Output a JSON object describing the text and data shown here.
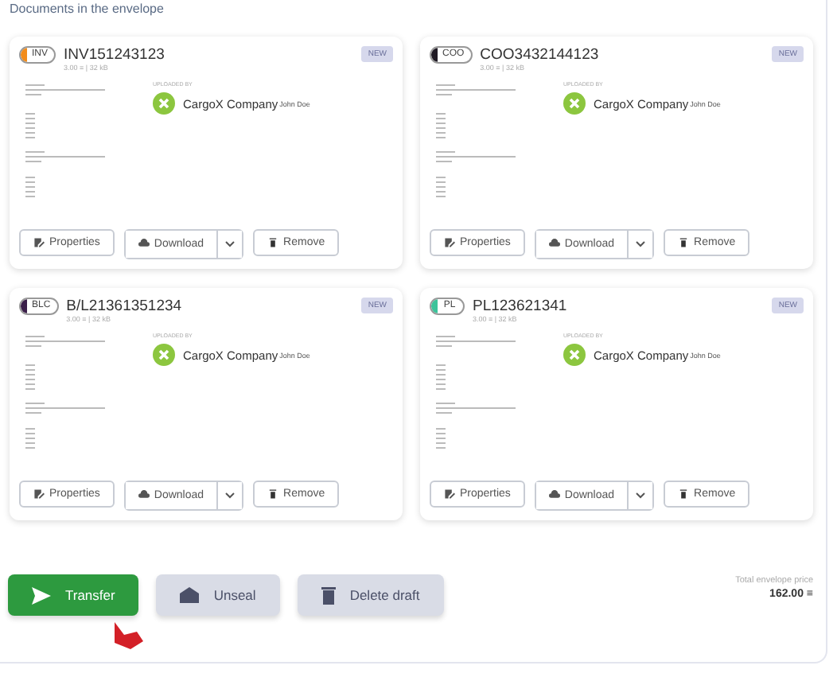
{
  "section_title": "Documents in the envelope",
  "documents": [
    {
      "code": "INV",
      "color": "#f28c1b",
      "title": "INV151243123",
      "meta": "3.00 ≡ | 32 kB",
      "tag": "NEW",
      "uploaded_label": "UPLOADED BY",
      "company": "CargoX Company",
      "user": "John Doe",
      "actions": {
        "properties": "Properties",
        "download": "Download",
        "remove": "Remove"
      }
    },
    {
      "code": "COO",
      "color": "#1f1a24",
      "title": "COO3432144123",
      "meta": "3.00 ≡ | 32 kB",
      "tag": "NEW",
      "uploaded_label": "UPLOADED BY",
      "company": "CargoX Company",
      "user": "John Doe",
      "actions": {
        "properties": "Properties",
        "download": "Download",
        "remove": "Remove"
      }
    },
    {
      "code": "BLC",
      "color": "#3b1f4a",
      "title": "B/L21361351234",
      "meta": "3.00 ≡ | 32 kB",
      "tag": "NEW",
      "uploaded_label": "UPLOADED BY",
      "company": "CargoX Company",
      "user": "John Doe",
      "actions": {
        "properties": "Properties",
        "download": "Download",
        "remove": "Remove"
      }
    },
    {
      "code": "PL",
      "color": "#3cc39a",
      "title": "PL123621341",
      "meta": "3.00 ≡ | 32 kB",
      "tag": "NEW",
      "uploaded_label": "UPLOADED BY",
      "company": "CargoX Company",
      "user": "John Doe",
      "actions": {
        "properties": "Properties",
        "download": "Download",
        "remove": "Remove"
      }
    }
  ],
  "footer": {
    "buttons": [
      {
        "kind": "primary",
        "label": "Transfer"
      },
      {
        "kind": "secondary",
        "label": "Unseal"
      },
      {
        "kind": "secondary",
        "label": "Delete draft"
      }
    ],
    "price_label": "Total envelope price",
    "price": "162.00 ≡"
  }
}
